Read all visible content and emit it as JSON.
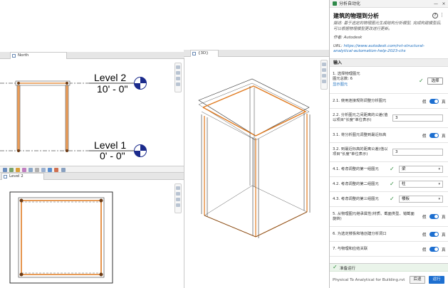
{
  "views": {
    "north_tab": "North",
    "view3d_tab": "{3D}",
    "level2_tab": "Level 2",
    "levels": [
      {
        "name": "Level 2",
        "elevation": "10' - 0\""
      },
      {
        "name": "Level 1",
        "elevation": "0' - 0\""
      }
    ]
  },
  "panel": {
    "window_title": "分析自动化",
    "close_glyph": "×",
    "min_glyph": "—",
    "title": "建筑的物理到分析",
    "description": "描述: 基于选定的物理图元生成结构分析模型, 完成构建模型后, 可以根据物理模型更改进行更新。",
    "author_label": "作者:",
    "author": "Autodesk",
    "url_label": "URL:",
    "url": "https://www.autodesk.com/rvt-structural-analytical-automation-help-2023-chs",
    "help_glyph": "?",
    "more_glyph": "⋮",
    "section_title": "输入",
    "steps": [
      {
        "label": "1. 选择物理图元",
        "sub1": "图元总数: 6",
        "sub2": "显示图元",
        "button": "选择"
      },
      {
        "label": "2.1. 使用连接规则调整分析图元",
        "toggle_off": "假",
        "toggle_on": "真"
      },
      {
        "label": "2.2. 分析图元之间距离的公差(值以项目\"长度\"单位表示)",
        "value": "3"
      },
      {
        "label": "3.1. 将分析图元调整到最近标高",
        "toggle_off": "假",
        "toggle_on": "真"
      },
      {
        "label": "3.2. 到最近标高的距离公差(值以项目\"长度\"单位表示)",
        "value": "3"
      },
      {
        "label": "4.1. 考虑调整的第一组图元",
        "value": "梁"
      },
      {
        "label": "4.2. 考虑调整的第二组图元",
        "value": "柱"
      },
      {
        "label": "4.3. 考虑调整的第三组图元",
        "value": "楼板"
      },
      {
        "label": "5. 从物理图元继承属性(材质、截面类型、错截面旋转)",
        "toggle_off": "假",
        "toggle_on": "真"
      },
      {
        "label": "6. 为选定楼板和墙创建分析洞口",
        "toggle_off": "假",
        "toggle_on": "真"
      },
      {
        "label": "7. 与物理和应结关联",
        "toggle_off": "假",
        "toggle_on": "真"
      }
    ],
    "ready": "准备运行",
    "file": "Physical To Analytical for Building.rvt",
    "back": "后退",
    "run": "运行"
  }
}
